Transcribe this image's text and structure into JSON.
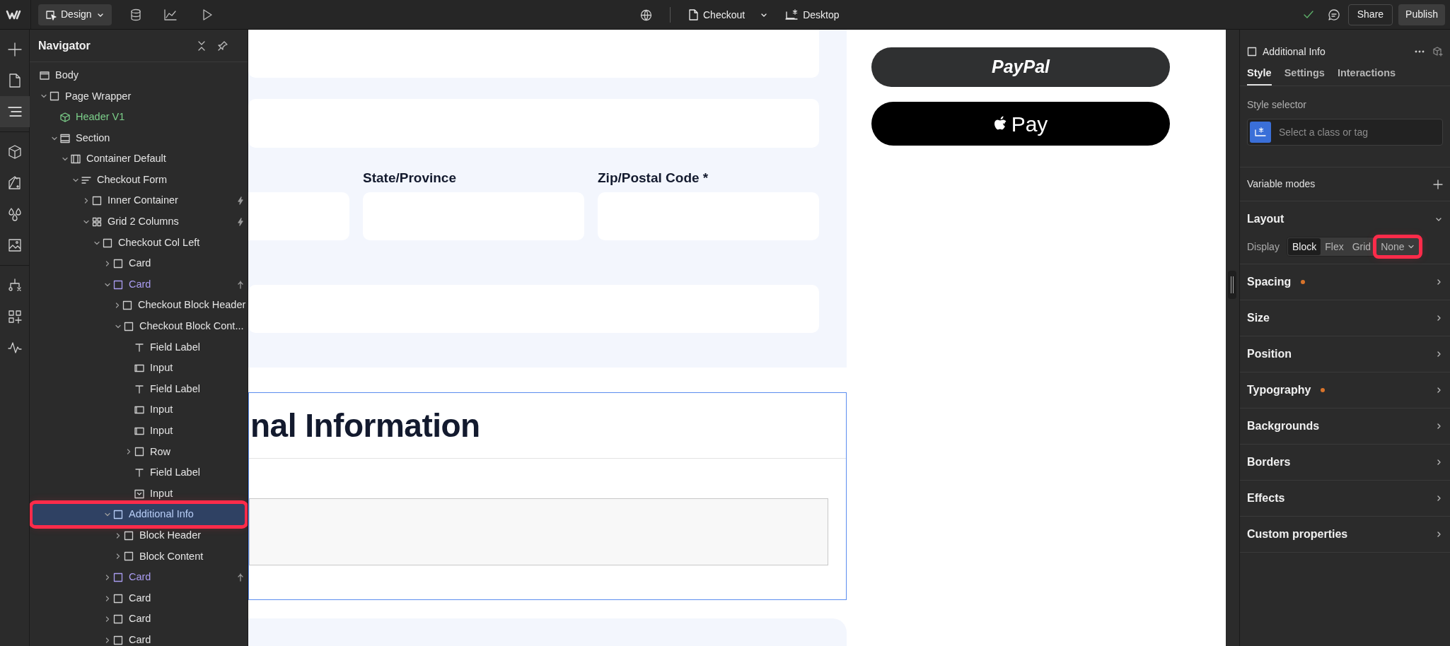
{
  "topbar": {
    "mode_button": "Design",
    "page": "Checkout",
    "breakpoint": "Desktop",
    "share": "Share",
    "publish": "Publish",
    "saved": true
  },
  "rail": [
    {
      "kind": "add",
      "selected": false
    },
    {
      "kind": "pages",
      "selected": false
    },
    {
      "kind": "navigator",
      "selected": true
    },
    {
      "kind": "components",
      "selected": false
    },
    {
      "kind": "styles",
      "selected": false
    },
    {
      "kind": "variables",
      "selected": false
    },
    {
      "kind": "assets",
      "selected": false
    },
    {
      "kind": "logic",
      "selected": false
    },
    {
      "kind": "apps",
      "selected": false
    },
    {
      "kind": "audit",
      "selected": false
    }
  ],
  "navigator": {
    "title": "Navigator",
    "tree": [
      {
        "label": "Body",
        "kind": "body",
        "selected": false
      },
      {
        "label": "Page Wrapper",
        "kind": "box",
        "expanded": true,
        "selected": false,
        "children": [
          {
            "label": "Header V1",
            "kind": "component",
            "selected": false,
            "color": "#7ccf8a"
          },
          {
            "label": "Section",
            "kind": "section",
            "expanded": true,
            "selected": false,
            "children": [
              {
                "label": "Container Default",
                "kind": "container",
                "expanded": true,
                "selected": false,
                "children": [
                  {
                    "label": "Checkout Form",
                    "kind": "form",
                    "expanded": true,
                    "selected": false,
                    "children": [
                      {
                        "label": "Inner Container",
                        "kind": "box",
                        "expanded": false,
                        "selected": false,
                        "interactions": true
                      },
                      {
                        "label": "Grid 2 Columns",
                        "kind": "grid",
                        "expanded": true,
                        "selected": false,
                        "interactions": true,
                        "children": [
                          {
                            "label": "Checkout Col Left",
                            "kind": "box",
                            "expanded": true,
                            "selected": false,
                            "children": [
                              {
                                "label": "Card",
                                "kind": "box",
                                "expanded": false,
                                "selected": false
                              },
                              {
                                "label": "Card",
                                "kind": "box",
                                "expanded": true,
                                "selected": false,
                                "color": "#a99cf0",
                                "linked": true,
                                "children": [
                                  {
                                    "label": "Checkout Block Header",
                                    "kind": "box",
                                    "expanded": false,
                                    "selected": false
                                  },
                                  {
                                    "label": "Checkout Block Cont...",
                                    "kind": "box",
                                    "expanded": true,
                                    "selected": false,
                                    "children": [
                                      {
                                        "label": "Field Label",
                                        "kind": "text",
                                        "selected": false
                                      },
                                      {
                                        "label": "Input",
                                        "kind": "input",
                                        "selected": false
                                      },
                                      {
                                        "label": "Field Label",
                                        "kind": "text",
                                        "selected": false
                                      },
                                      {
                                        "label": "Input",
                                        "kind": "input",
                                        "selected": false
                                      },
                                      {
                                        "label": "Input",
                                        "kind": "input",
                                        "selected": false
                                      },
                                      {
                                        "label": "Row",
                                        "kind": "box",
                                        "expanded": false,
                                        "selected": false
                                      },
                                      {
                                        "label": "Field Label",
                                        "kind": "text",
                                        "selected": false
                                      },
                                      {
                                        "label": "Input",
                                        "kind": "select",
                                        "selected": false
                                      }
                                    ]
                                  }
                                ]
                              },
                              {
                                "label": "Additional Info",
                                "kind": "box",
                                "expanded": true,
                                "selected": true,
                                "highlighted": true,
                                "children": [
                                  {
                                    "label": "Block Header",
                                    "kind": "box",
                                    "expanded": false,
                                    "selected": false
                                  },
                                  {
                                    "label": "Block Content",
                                    "kind": "box",
                                    "expanded": false,
                                    "selected": false
                                  }
                                ]
                              },
                              {
                                "label": "Card",
                                "kind": "box",
                                "expanded": false,
                                "selected": false,
                                "color": "#a99cf0",
                                "linked": true
                              },
                              {
                                "label": "Card",
                                "kind": "box",
                                "expanded": false,
                                "selected": false
                              },
                              {
                                "label": "Card",
                                "kind": "box",
                                "expanded": false,
                                "selected": false
                              },
                              {
                                "label": "Card",
                                "kind": "box",
                                "expanded": false,
                                "selected": false
                              }
                            ]
                          }
                        ]
                      }
                    ]
                  }
                ]
              }
            ]
          }
        ]
      }
    ]
  },
  "canvas": {
    "field_labels": [
      "State/Province",
      "Zip/Postal Code *"
    ],
    "heading": "nal Information",
    "payment_buttons": [
      {
        "kind": "paypal",
        "label": "PayPal"
      },
      {
        "kind": "applepay",
        "label": "Pay"
      }
    ]
  },
  "inspector": {
    "element": "Additional Info",
    "tabs": [
      {
        "label": "Style",
        "selected": true
      },
      {
        "label": "Settings",
        "selected": false
      },
      {
        "label": "Interactions",
        "selected": false
      }
    ],
    "style_selector": {
      "label": "Style selector",
      "placeholder": "Select a class or tag"
    },
    "variable_modes": "Variable modes",
    "layout": {
      "title": "Layout",
      "expanded": true,
      "display_label": "Display",
      "options": [
        {
          "label": "Block",
          "selected": true
        },
        {
          "label": "Flex",
          "selected": false
        },
        {
          "label": "Grid",
          "selected": false
        },
        {
          "label": "None",
          "selected": false,
          "dropdown": true,
          "highlighted": true
        }
      ]
    },
    "sections": [
      {
        "title": "Spacing",
        "modified": true
      },
      {
        "title": "Size",
        "modified": false
      },
      {
        "title": "Position",
        "modified": false
      },
      {
        "title": "Typography",
        "modified": true
      },
      {
        "title": "Backgrounds",
        "modified": false
      },
      {
        "title": "Borders",
        "modified": false
      },
      {
        "title": "Effects",
        "modified": false
      },
      {
        "title": "Custom properties",
        "modified": false
      }
    ]
  }
}
